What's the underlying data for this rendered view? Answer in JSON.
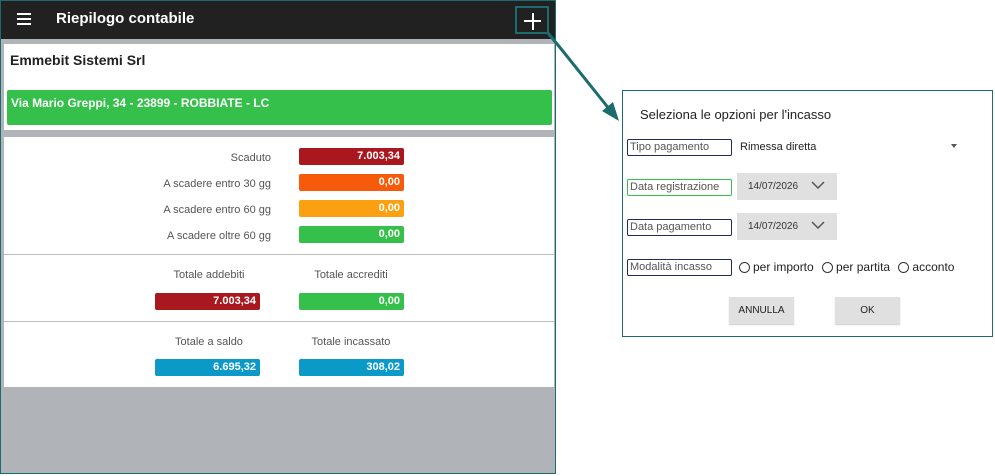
{
  "app": {
    "title": "Riepilogo contabile",
    "icons": {
      "menu": "hamburger-icon",
      "add": "plus-icon"
    }
  },
  "customer": {
    "name": "Emmebit Sistemi Srl",
    "address": "Via Mario Greppi, 34 - 23899 - ROBBIATE - LC"
  },
  "aging": [
    {
      "label": "Scaduto",
      "value": "7.003,34",
      "color": "#a8181e"
    },
    {
      "label": "A scadere entro 30 gg",
      "value": "0,00",
      "color": "#f65a0a"
    },
    {
      "label": "A scadere entro 60 gg",
      "value": "0,00",
      "color": "#fba010"
    },
    {
      "label": "A scadere oltre 60 gg",
      "value": "0,00",
      "color": "#34c04a"
    }
  ],
  "totals": {
    "addebiti": {
      "label": "Totale addebiti",
      "value": "7.003,34",
      "color": "#a8181e"
    },
    "accrediti": {
      "label": "Totale accrediti",
      "value": "0,00",
      "color": "#34c04a"
    },
    "saldo": {
      "label": "Totale a saldo",
      "value": "6.695,32",
      "color": "#0b9ac8"
    },
    "incassato": {
      "label": "Totale incassato",
      "value": "308,02",
      "color": "#0b9ac8"
    }
  },
  "dialog": {
    "title": "Seleziona le opzioni per l'incasso",
    "tipo_pagamento": {
      "label": "Tipo pagamento",
      "value": "Rimessa diretta"
    },
    "data_registrazione": {
      "label": "Data registrazione",
      "value": "14/07/2026"
    },
    "data_pagamento": {
      "label": "Data pagamento",
      "value": "14/07/2026"
    },
    "modalita": {
      "label": "Modalità incasso",
      "options": [
        "per importo",
        "per partita",
        "acconto"
      ]
    },
    "buttons": {
      "cancel": "ANNULLA",
      "ok": "OK"
    }
  },
  "colors": {
    "appbar": "#212121",
    "highlight": "#1b6b6f",
    "green": "#34c04a",
    "red": "#a8181e",
    "blue": "#0b9ac8"
  }
}
